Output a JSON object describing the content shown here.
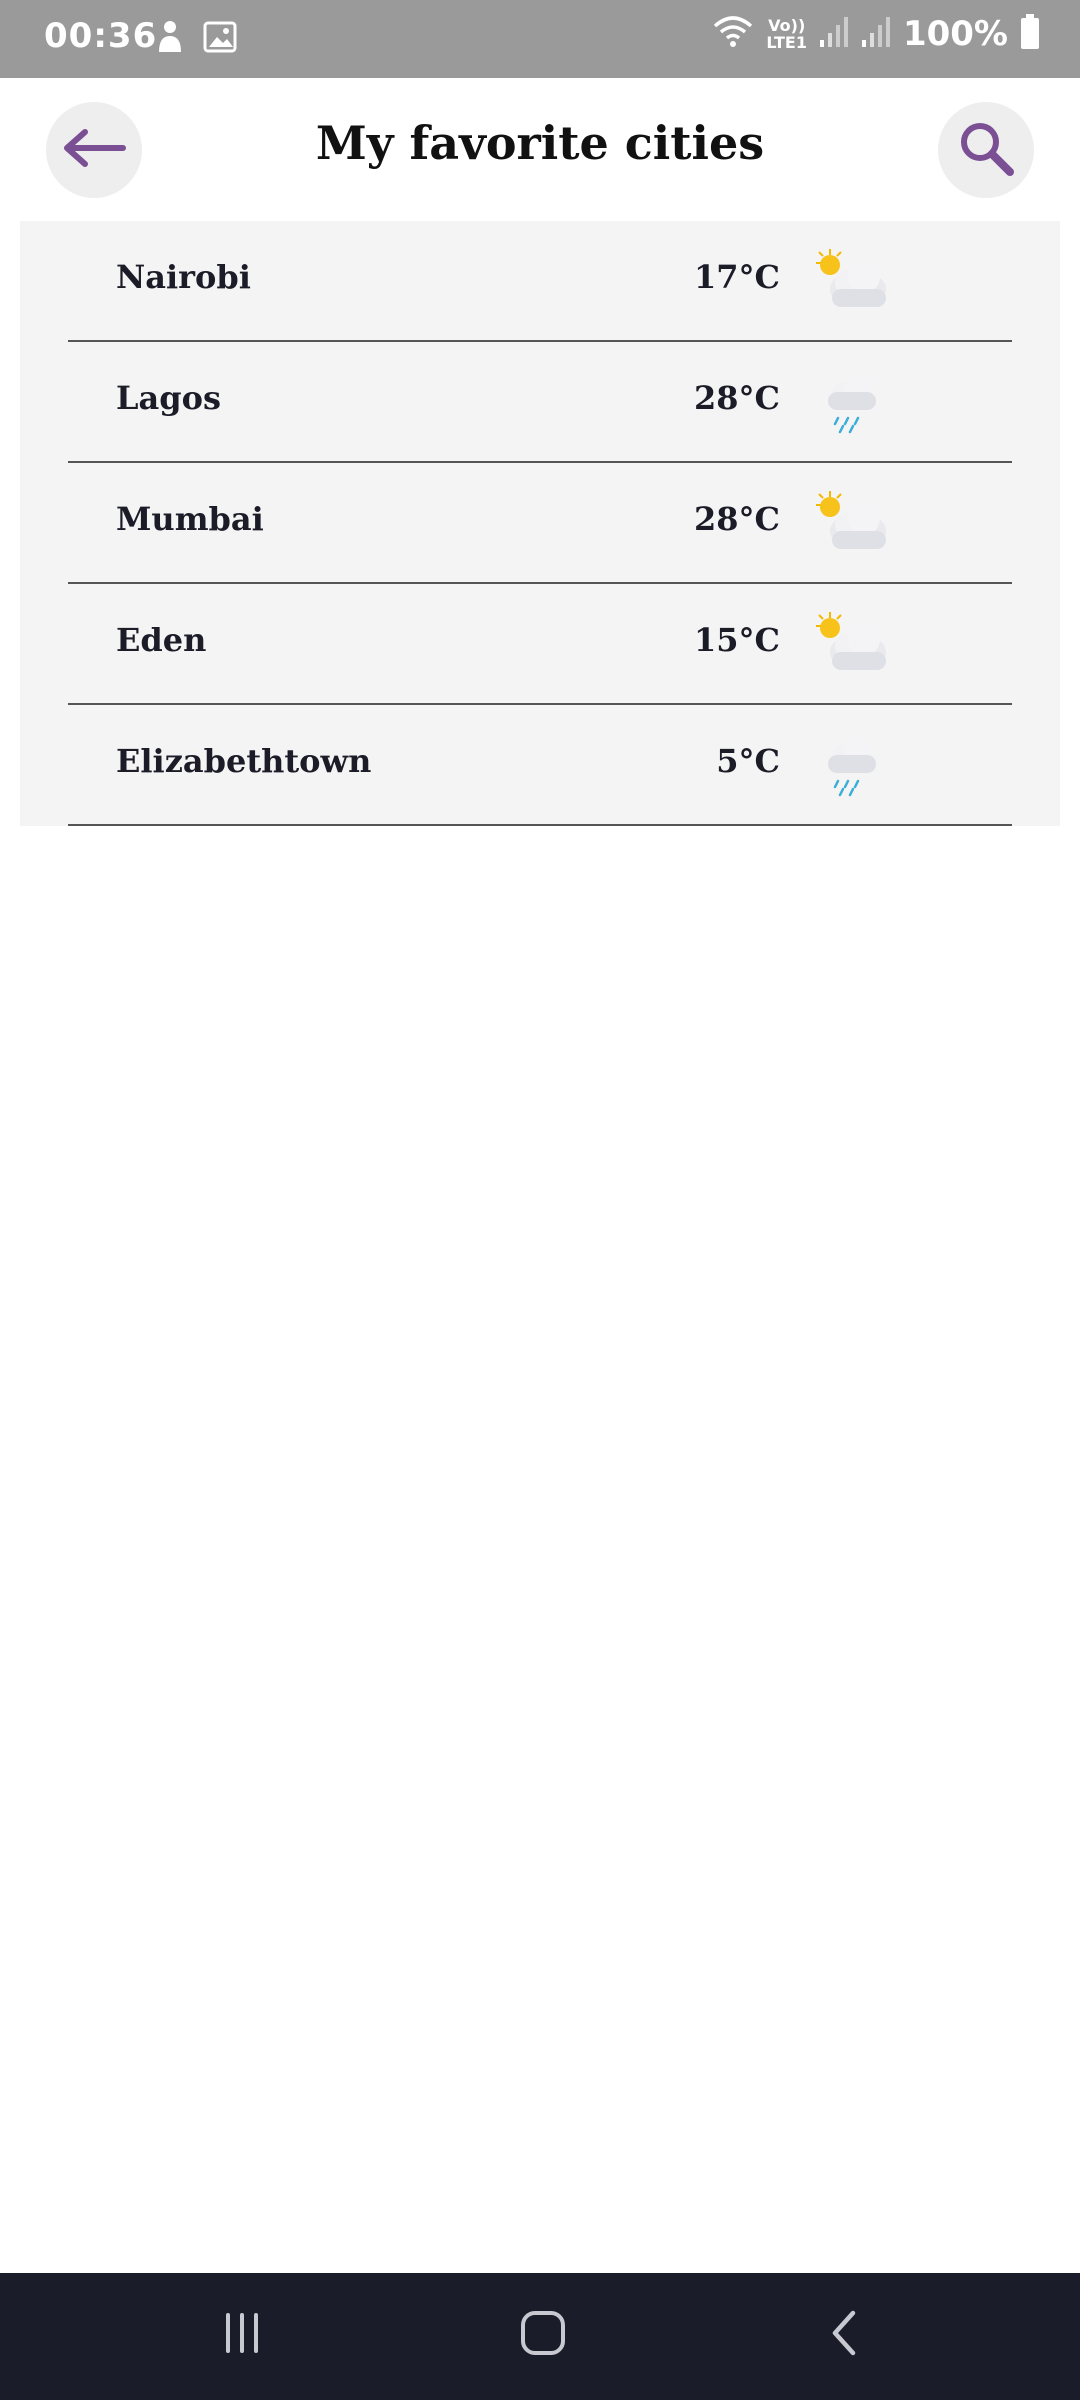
{
  "status_bar": {
    "time": "00:36",
    "battery_text": "100%",
    "network_label_top": "Vo))",
    "network_label_bottom": "LTE1",
    "icons": [
      "person-icon",
      "image-icon",
      "wifi-icon",
      "signal-icon",
      "signal-icon",
      "battery-icon"
    ]
  },
  "header": {
    "title": "My favorite cities",
    "back_icon": "arrow-left-icon",
    "search_icon": "search-icon",
    "accent_color": "#7a4f93"
  },
  "cities": [
    {
      "name": "Nairobi",
      "temp": "17°C",
      "icon": "partly-cloudy-icon"
    },
    {
      "name": "Lagos",
      "temp": "28°C",
      "icon": "rain-cloud-icon"
    },
    {
      "name": "Mumbai",
      "temp": "28°C",
      "icon": "partly-cloudy-icon"
    },
    {
      "name": "Eden",
      "temp": "15°C",
      "icon": "partly-cloudy-icon"
    },
    {
      "name": "Elizabethtown",
      "temp": "5°C",
      "icon": "rain-cloud-icon"
    }
  ],
  "nav_bar": {
    "buttons": [
      "recent-apps-icon",
      "home-icon",
      "back-icon"
    ]
  }
}
